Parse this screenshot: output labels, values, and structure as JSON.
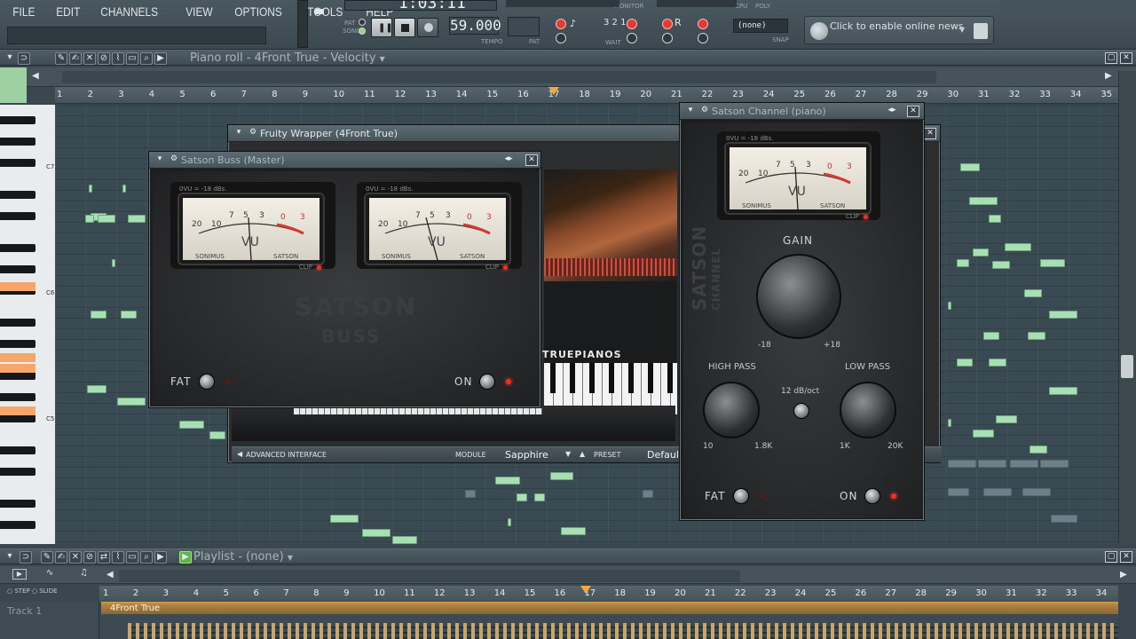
{
  "menu": [
    "FILE",
    "EDIT",
    "CHANNELS",
    "VIEW",
    "OPTIONS",
    "TOOLS",
    "HELP"
  ],
  "transport": {
    "pat_label": "PAT",
    "song_label": "SONG",
    "time": "1:03:11",
    "tempo": "59.000",
    "tempo_label": "TEMPO",
    "pat_num_label": "PAT",
    "monitor_label": "MONITOR",
    "cpu_label": "CPU",
    "poly_label": "POLY",
    "wait_label": "WAIT",
    "snap_label": "SNAP",
    "snap_value": "(none)",
    "news": "Click to enable online news"
  },
  "piano_roll": {
    "title": "Piano roll - 4Front True",
    "mode": "Velocity",
    "ruler": [
      "1",
      "2",
      "3",
      "4",
      "5",
      "6",
      "7",
      "8",
      "9",
      "10",
      "11",
      "12",
      "13",
      "14",
      "15",
      "16",
      "17",
      "18",
      "19",
      "20",
      "21",
      "22",
      "23",
      "24",
      "25",
      "26",
      "27",
      "28",
      "29",
      "30",
      "31",
      "32",
      "33",
      "34",
      "35"
    ],
    "octaves": [
      "C7",
      "C6",
      "C5"
    ],
    "playhead_bar": 16.8
  },
  "wrapper": {
    "title": "Fruity Wrapper (4Front True)",
    "brand": "TRUEPIANOS",
    "advanced": "ADVANCED INTERFACE",
    "module_label": "MODULE",
    "module": "Sapphire",
    "preset_label": "PRESET",
    "preset": "Default"
  },
  "buss": {
    "title": "Satson Buss (Master)",
    "vu_header": "0VU = -18 dBs.",
    "scale": [
      "20",
      "10",
      "7",
      "5",
      "3",
      "0",
      "3"
    ],
    "vu": "VU",
    "left": "SONIMUS",
    "right": "SATSON",
    "clip": "CLIP",
    "logo1": "SATSON",
    "logo2": "BUSS",
    "fat": "FAT",
    "on": "ON"
  },
  "channel": {
    "title": "Satson Channel (piano)",
    "vu_header": "0VU = -18 dBs.",
    "scale": [
      "20",
      "10",
      "7",
      "5",
      "3",
      "0",
      "3"
    ],
    "vu": "VU",
    "left": "SONIMUS",
    "right": "SATSON",
    "clip": "CLIP",
    "side1": "SATSON",
    "side2": "CHANNEL",
    "gain": "GAIN",
    "gain_min": "-18",
    "gain_max": "+18",
    "hp": "HIGH PASS",
    "hp_min": "10",
    "hp_max": "1.8K",
    "slope": "12 dB/oct",
    "lp": "LOW PASS",
    "lp_min": "1K",
    "lp_max": "20K",
    "fat": "FAT",
    "on": "ON"
  },
  "playlist": {
    "title": "Playlist - (none)",
    "step": "STEP",
    "slide": "SLIDE",
    "track": "Track 1",
    "pattern": "4Front True",
    "ruler": [
      "1",
      "2",
      "3",
      "4",
      "5",
      "6",
      "7",
      "8",
      "9",
      "10",
      "11",
      "12",
      "13",
      "14",
      "15",
      "16",
      "17",
      "18",
      "19",
      "20",
      "21",
      "22",
      "23",
      "24",
      "25",
      "26",
      "27",
      "28",
      "29",
      "30",
      "31",
      "32",
      "33",
      "34"
    ]
  }
}
